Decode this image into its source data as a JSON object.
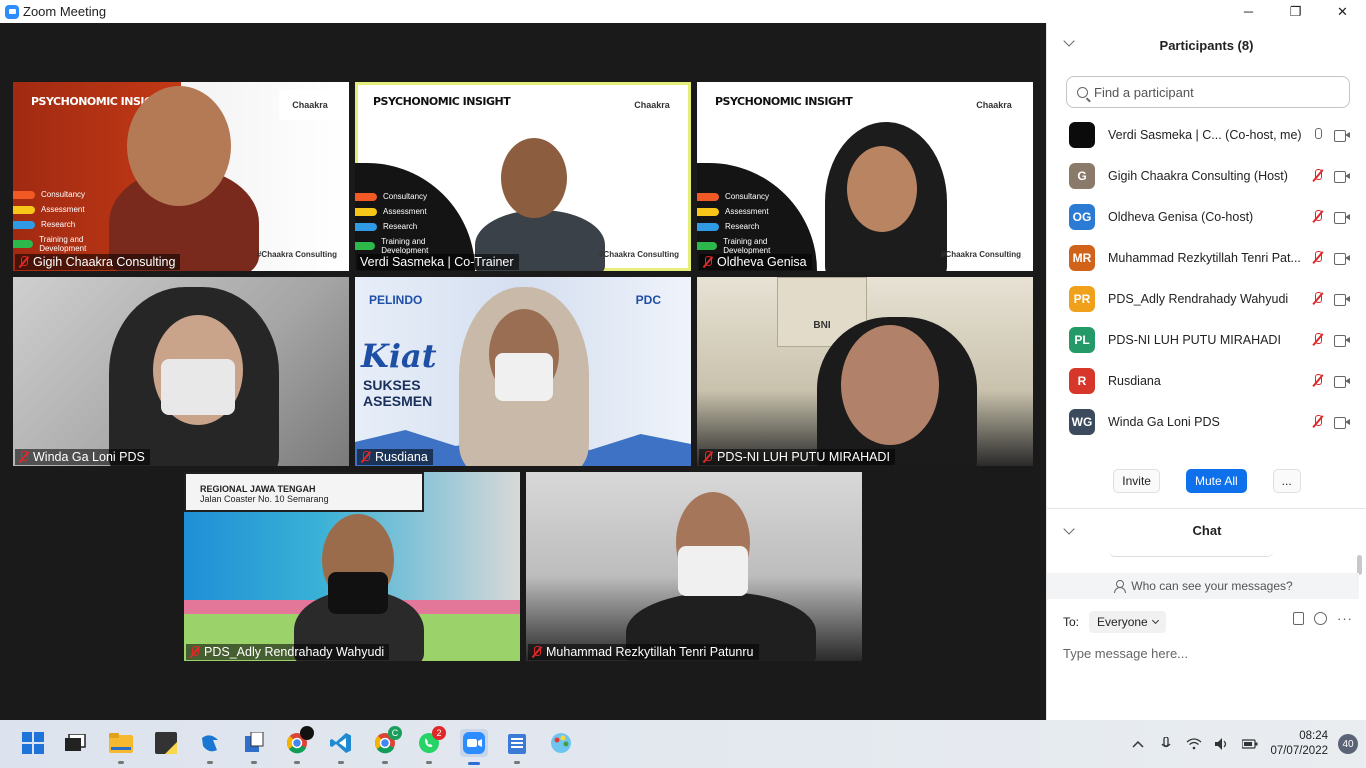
{
  "window": {
    "title": "Zoom Meeting",
    "minimize": "─",
    "restore": "❐",
    "close": "✕"
  },
  "slides": {
    "brand_title": "PSYCHONOMIC INSIGHT",
    "logo_text": "Chaakra",
    "hashtag": "#Chaakra Consulting",
    "menu": [
      "Consultancy",
      "Assessment",
      "Research",
      "Training and Development"
    ],
    "pelindo_logo": "PELINDO",
    "pdc_logo": "PDC",
    "kiat_title": "Kiat",
    "kiat_line1": "SUKSES",
    "kiat_line2": "ASESMEN",
    "office_sign": "BNI",
    "regional_sign_line1": "REGIONAL JAWA TENGAH",
    "regional_sign_line2": "Jalan Coaster No. 10 Semarang"
  },
  "tiles": [
    {
      "name": "Gigih Chaakra Consulting",
      "muted": true
    },
    {
      "name": "Verdi Sasmeka | Co-Trainer",
      "muted": false,
      "active": true
    },
    {
      "name": "Oldheva Genisa",
      "muted": true
    },
    {
      "name": "Winda Ga Loni PDS",
      "muted": true
    },
    {
      "name": "Rusdiana",
      "muted": true
    },
    {
      "name": "PDS-NI LUH PUTU MIRAHADI",
      "muted": true
    },
    {
      "name": "PDS_Adly Rendrahady Wahyudi",
      "muted": true
    },
    {
      "name": "Muhammad Rezkytillah Tenri Patunru",
      "muted": true
    }
  ],
  "participants_panel": {
    "title": "Participants (8)",
    "search_placeholder": "Find a participant",
    "participants": [
      {
        "initials": "",
        "name": "Verdi Sasmeka | C... (Co-host, me)",
        "color": "#0b0b0b",
        "muted": false
      },
      {
        "initials": "G",
        "name": "Gigih Chaakra Consulting (Host)",
        "color": "#8a7a6a",
        "muted": true
      },
      {
        "initials": "OG",
        "name": "Oldheva Genisa (Co-host)",
        "color": "#2b7bd4",
        "muted": true
      },
      {
        "initials": "MR",
        "name": "Muhammad Rezkytillah Tenri Pat...",
        "color": "#d0621a",
        "muted": true
      },
      {
        "initials": "PR",
        "name": "PDS_Adly Rendrahady Wahyudi",
        "color": "#f0a11c",
        "muted": true
      },
      {
        "initials": "PL",
        "name": "PDS-NI LUH PUTU MIRAHADI",
        "color": "#239a67",
        "muted": true
      },
      {
        "initials": "R",
        "name": "Rusdiana",
        "color": "#d6372a",
        "muted": true
      },
      {
        "initials": "WG",
        "name": "Winda Ga Loni PDS",
        "color": "#3b4a5c",
        "muted": true
      }
    ],
    "invite_label": "Invite",
    "mute_all_label": "Mute All",
    "more_label": "..."
  },
  "chat_panel": {
    "title": "Chat",
    "who_can_see": "Who can see your messages?",
    "to_label": "To:",
    "to_value": "Everyone",
    "message_placeholder": "Type message here...",
    "more_label": "···"
  },
  "taskbar": {
    "time": "08:24",
    "date": "07/07/2022",
    "notifications": "40",
    "whatsapp_badge": "2",
    "chrome_badge": "C"
  }
}
